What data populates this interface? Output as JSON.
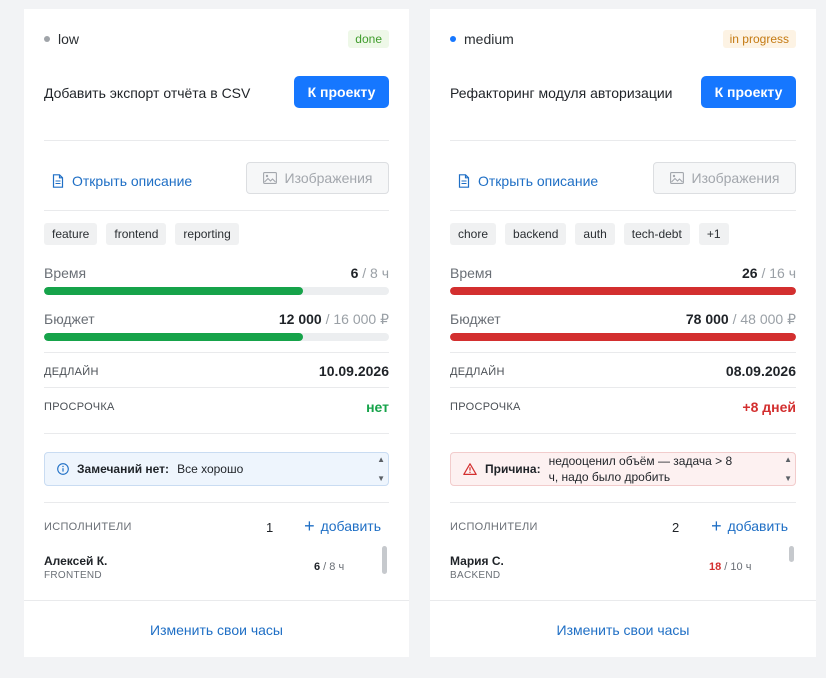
{
  "colors": {
    "accent": "#1677ff",
    "link": "#1f6fc5",
    "ok": "#16a34a",
    "danger": "#d32f2f",
    "low_dot": "#a0a4a9",
    "medium_dot": "#1677ff"
  },
  "cards": [
    {
      "priority": "low",
      "status": "done",
      "title": "Добавить экспорт отчёта в CSV",
      "project_button": "К проекту",
      "open_description": "Открыть описание",
      "images_button": "Изображения",
      "tags": [
        "feature",
        "frontend",
        "reporting"
      ],
      "time": {
        "label": "Время",
        "value": "6",
        "total": " / 8 ч",
        "progress": 0.75
      },
      "budget": {
        "label": "Бюджет",
        "value": "12 000",
        "total": " / 16 000 ₽",
        "progress": 0.75
      },
      "deadline": {
        "label": "ДЕДЛАЙН",
        "value": "10.09.2026"
      },
      "overdue": {
        "label": "ПРОСРОЧКА",
        "value": "нет"
      },
      "note": {
        "label": "Замечаний нет:",
        "text": "Все хорошо"
      },
      "executors": {
        "label": "ИСПОЛНИТЕЛИ",
        "count": "1",
        "add": "добавить"
      },
      "person": {
        "name": "Алексей К.",
        "role": "FRONTEND",
        "hours": "6",
        "hours_total": " / 8 ч"
      },
      "footer": "Изменить свои часы"
    },
    {
      "priority": "medium",
      "status": "in progress",
      "title": "Рефакторинг модуля авторизации",
      "project_button": "К проекту",
      "open_description": "Открыть описание",
      "images_button": "Изображения",
      "tags": [
        "chore",
        "backend",
        "auth",
        "tech-debt",
        "+1"
      ],
      "time": {
        "label": "Время",
        "value": "26",
        "total": " / 16 ч",
        "progress": 1
      },
      "budget": {
        "label": "Бюджет",
        "value": "78 000",
        "total": " / 48 000 ₽",
        "progress": 1
      },
      "deadline": {
        "label": "ДЕДЛАЙН",
        "value": "08.09.2026"
      },
      "overdue": {
        "label": "ПРОСРОЧКА",
        "value": "+8 дней"
      },
      "note": {
        "label": "Причина:",
        "text": "недооценил объём — задача > 8 ч, надо было дробить"
      },
      "executors": {
        "label": "ИСПОЛНИТЕЛИ",
        "count": "2",
        "add": "добавить"
      },
      "person": {
        "name": "Мария С.",
        "role": "BACKEND",
        "hours": "18",
        "hours_total": " / 10 ч"
      },
      "footer": "Изменить свои часы"
    }
  ]
}
